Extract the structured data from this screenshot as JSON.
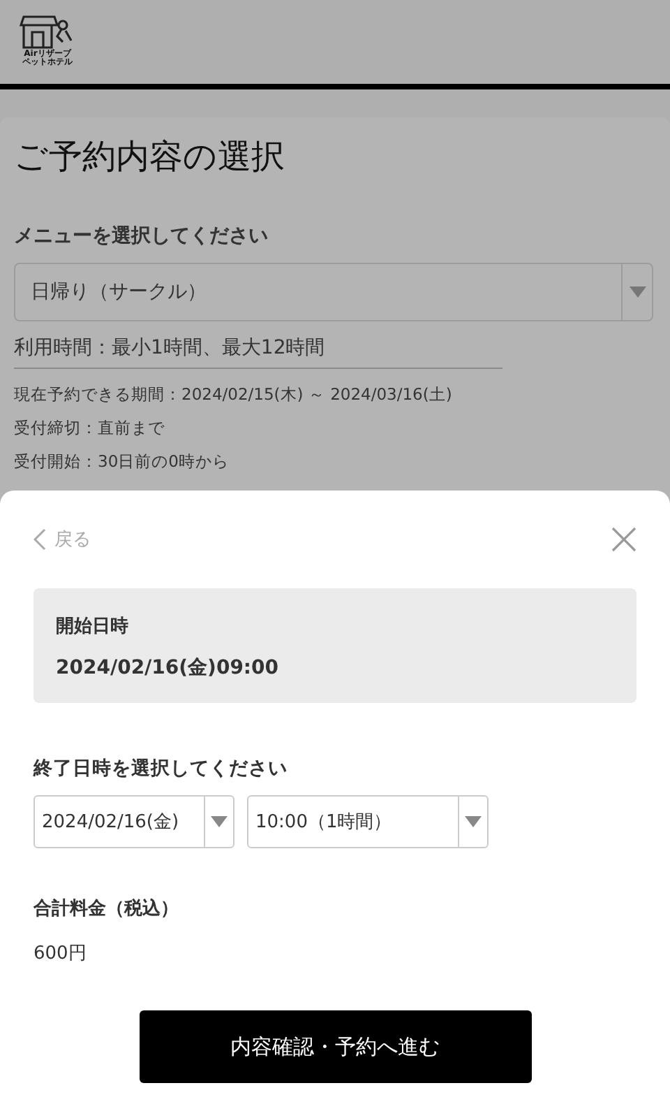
{
  "header": {
    "logo_lines": [
      "Airリザーブ",
      "ペットホテル"
    ]
  },
  "page": {
    "title": "ご予約内容の選択",
    "menu_label": "メニューを選択してください",
    "menu_value": "日帰り（サークル）",
    "usage_time": "利用時間：最小1時間、最大12時間",
    "notes": [
      "現在予約できる期間：2024/02/15(木) ～ 2024/03/16(土)",
      "受付締切：直前まで",
      "受付開始：30日前の0時から"
    ]
  },
  "sheet": {
    "back": "戻る",
    "start_label": "開始日時",
    "start_value": "2024/02/16(金)09:00",
    "end_label": "終了日時を選択してください",
    "selects": [
      {
        "value": "2024/02/16(金)"
      },
      {
        "value": "10:00（1時間）"
      }
    ],
    "total_label": "合計料金（税込）",
    "total_value": "600円",
    "submit": "内容確認・予約へ進む"
  }
}
